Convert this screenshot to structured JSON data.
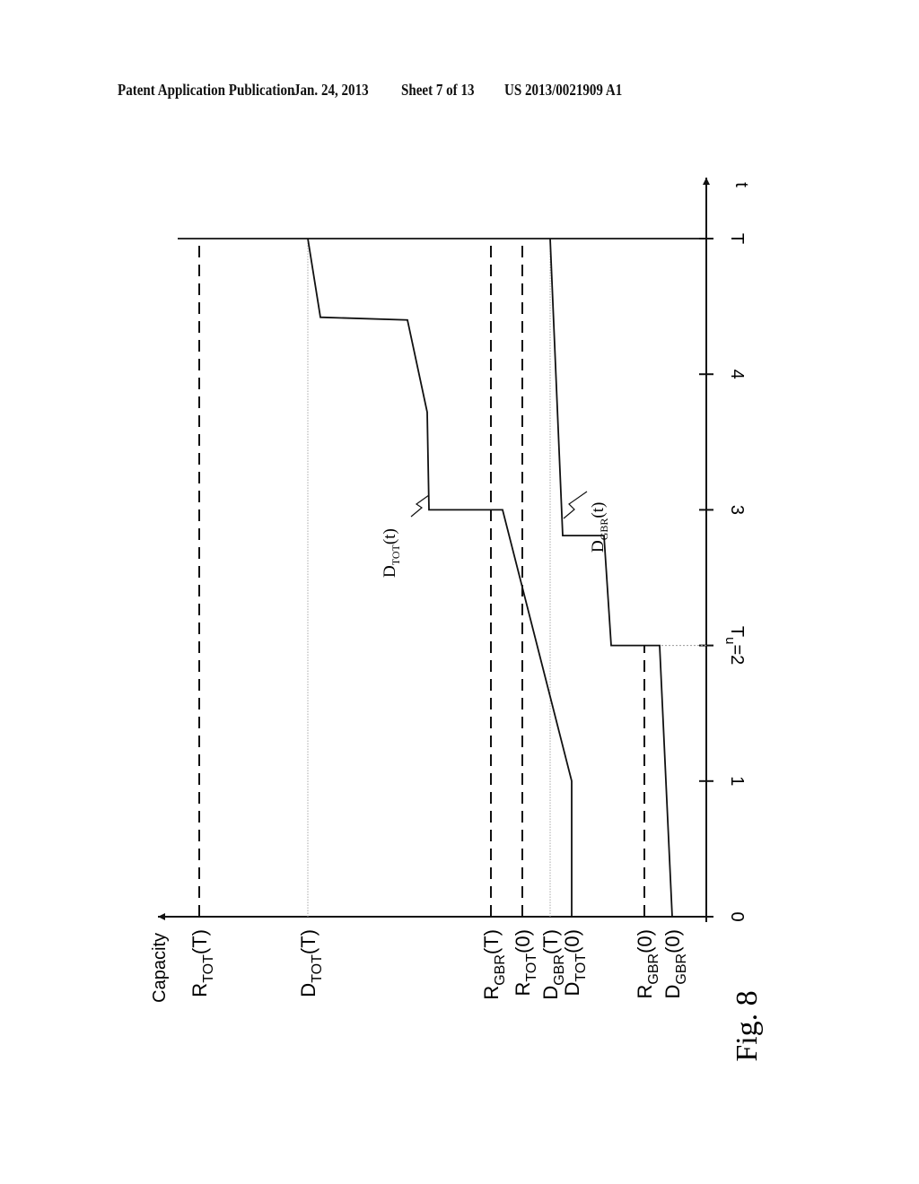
{
  "header": {
    "title": "Patent Application Publication",
    "date": "Jan. 24, 2013",
    "sheet": "Sheet 7 of 13",
    "number": "US 2013/0021909 A1"
  },
  "figure_label": "Fig. 8",
  "chart_data": {
    "type": "line",
    "title": "Fig. 8",
    "orientation": "rotated 90° (time axis vertical, capacity increases leftward)",
    "xlabel": "t",
    "ylabel": "Capacity",
    "x_ticks": [
      {
        "value": 0,
        "label": "0"
      },
      {
        "value": 1,
        "label": "1"
      },
      {
        "value": 2,
        "label": "Tu=2"
      },
      {
        "value": 3,
        "label": "3"
      },
      {
        "value": 4,
        "label": "4"
      },
      {
        "value": 5,
        "label": "T"
      }
    ],
    "xlim": [
      0,
      5.5
    ],
    "ylim": [
      0,
      60
    ],
    "y_levels": [
      {
        "name": "RTOT(T)",
        "base": "R",
        "sub": "TOT",
        "arg": "(T)",
        "value": 56.5,
        "style": "dashed",
        "extent": [
          0,
          5
        ]
      },
      {
        "name": "DTOT(T)",
        "base": "D",
        "sub": "TOT",
        "arg": "(T)",
        "value": 44.4,
        "style": "dotted",
        "extent": [
          0,
          5
        ]
      },
      {
        "name": "RGBR(T)",
        "base": "R",
        "sub": "GBR",
        "arg": "(T)",
        "value": 24.0,
        "style": "dashed",
        "extent": [
          0,
          5
        ]
      },
      {
        "name": "RTOT(0)",
        "base": "R",
        "sub": "TOT",
        "arg": "(0)",
        "value": 20.5,
        "style": "dashed",
        "extent": [
          0,
          5
        ]
      },
      {
        "name": "DGBR(T)",
        "base": "D",
        "sub": "GBR",
        "arg": "(T)",
        "value": 17.4,
        "style": "dotted",
        "extent": [
          0,
          5
        ]
      },
      {
        "name": "DTOT(0)",
        "base": "D",
        "sub": "TOT",
        "arg": "(0)",
        "value": 15.0,
        "style": "none",
        "extent": [
          0,
          0
        ]
      },
      {
        "name": "RGBR(0)",
        "base": "R",
        "sub": "GBR",
        "arg": "(0)",
        "value": 6.9,
        "style": "dashed",
        "extent": [
          0,
          2
        ]
      },
      {
        "name": "DGBR(0)",
        "base": "D",
        "sub": "GBR",
        "arg": "(0)",
        "value": 3.8,
        "style": "none",
        "extent": [
          0,
          0
        ]
      }
    ],
    "series": [
      {
        "name": "DTOT(t)",
        "label_base": "D",
        "label_sub": "TOT",
        "label_arg": "(t)",
        "points": [
          [
            0,
            15.0
          ],
          [
            1,
            15.0
          ],
          [
            3,
            22.7
          ],
          [
            3,
            30.9
          ],
          [
            3.72,
            31.1
          ],
          [
            4.4,
            33.3
          ],
          [
            4.42,
            43.0
          ],
          [
            5,
            44.4
          ]
        ]
      },
      {
        "name": "DGBR(t)",
        "label_base": "D",
        "label_sub": "GBR",
        "label_arg": "(t)",
        "points": [
          [
            0,
            3.8
          ],
          [
            2,
            5.2
          ],
          [
            2,
            10.6
          ],
          [
            2.81,
            11.4
          ],
          [
            2.81,
            16.0
          ],
          [
            5,
            17.4
          ]
        ]
      }
    ],
    "reference_lines": [
      {
        "name": "t=T",
        "at_t": 5,
        "style": "solid"
      },
      {
        "name": "t=Tu",
        "at_t": 2,
        "style": "dotted",
        "capacity_range": [
          0,
          6.9
        ]
      }
    ],
    "grid": false,
    "legend": "none (curves labelled inline)"
  }
}
